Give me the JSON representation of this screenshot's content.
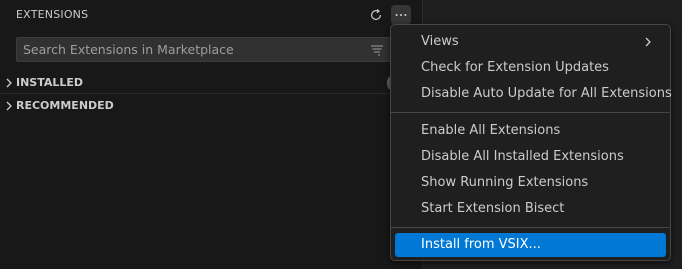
{
  "sidebar": {
    "title": "EXTENSIONS",
    "actions": {
      "refresh_icon": "refresh-icon",
      "more_icon": "more-actions-icon"
    },
    "search": {
      "placeholder": "Search Extensions in Marketplace",
      "value": "",
      "filter_icon": "filter-icon"
    },
    "sections": [
      {
        "label": "INSTALLED",
        "icon": "chevron-right-icon"
      },
      {
        "label": "RECOMMENDED",
        "icon": "chevron-right-icon"
      }
    ]
  },
  "menu": {
    "groups": [
      [
        "Views",
        "Check for Extension Updates",
        "Disable Auto Update for All Extensions"
      ],
      [
        "Enable All Extensions",
        "Disable All Installed Extensions",
        "Show Running Extensions",
        "Start Extension Bisect"
      ],
      [
        "Install from VSIX..."
      ]
    ],
    "active_item": "Install from VSIX...",
    "submenu_item": "Views"
  },
  "colors": {
    "background": "#181818",
    "menu_background": "#1f1f1f",
    "accent": "#0078d4",
    "text": "#cccccc"
  }
}
